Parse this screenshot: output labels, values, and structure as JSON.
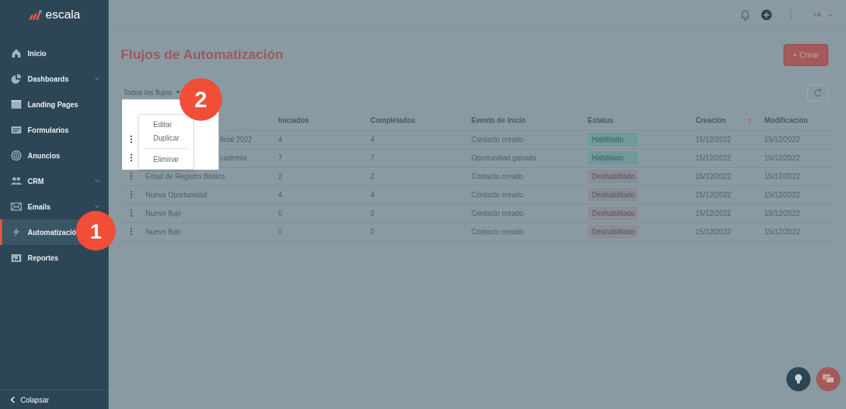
{
  "sidebar": {
    "logo": "escala",
    "items": [
      {
        "label": "Inicio",
        "expandable": false,
        "selected": false
      },
      {
        "label": "Dashboards",
        "expandable": true,
        "selected": false
      },
      {
        "label": "Landing Pages",
        "expandable": false,
        "selected": false
      },
      {
        "label": "Formularios",
        "expandable": false,
        "selected": false
      },
      {
        "label": "Anuncios",
        "expandable": false,
        "selected": false
      },
      {
        "label": "CRM",
        "expandable": true,
        "selected": false
      },
      {
        "label": "Emails",
        "expandable": true,
        "selected": false
      },
      {
        "label": "Automatizació",
        "expandable": false,
        "selected": true
      },
      {
        "label": "Reportes",
        "expandable": false,
        "selected": false
      }
    ],
    "collapse": "Colapsar"
  },
  "topbar": {
    "avatar": "LB"
  },
  "page": {
    "title": "Flujos de Automatización",
    "create_button": "+ Crear",
    "filter": "Todos los flujos"
  },
  "table": {
    "columns": [
      "Iniciados",
      "Completados",
      "Evento de inicio",
      "Estatus",
      "Creación",
      "Modificación"
    ],
    "rows": [
      {
        "name": "ficial 2022",
        "cut_off": true,
        "started": "4",
        "completed": "4",
        "trigger": "Contacto creado",
        "status": "Habilitado",
        "enabled": true,
        "created": "15/12/2022",
        "modified": "15/12/2022"
      },
      {
        "name": "cademia",
        "cut_off": true,
        "started": "7",
        "completed": "7",
        "trigger": "Oportunidad ganada",
        "status": "Habilitado",
        "enabled": true,
        "created": "15/12/2022",
        "modified": "15/12/2022"
      },
      {
        "name": "Email de Registro Básico",
        "started": "2",
        "completed": "2",
        "trigger": "Contacto creado",
        "status": "Deshabilitado",
        "enabled": false,
        "created": "15/12/2022",
        "modified": "15/12/2022"
      },
      {
        "name": "Nueva Oportunidad",
        "started": "4",
        "completed": "4",
        "trigger": "Contacto creado",
        "status": "Deshabilitado",
        "enabled": false,
        "created": "15/12/2022",
        "modified": "15/12/2022"
      },
      {
        "name": "Nuevo flujo",
        "started": "0",
        "completed": "0",
        "trigger": "Contacto creado",
        "status": "Deshabilitado",
        "enabled": false,
        "created": "15/12/2022",
        "modified": "15/12/2022"
      },
      {
        "name": "Nuevo flujo",
        "started": "0",
        "completed": "0",
        "trigger": "Contacto creado",
        "status": "Deshabilitado",
        "enabled": false,
        "created": "15/12/2022",
        "modified": "15/12/2022"
      }
    ]
  },
  "row_menu": [
    "Editar",
    "Duplicar",
    "Eliminar"
  ],
  "callouts": [
    "1",
    "2"
  ]
}
